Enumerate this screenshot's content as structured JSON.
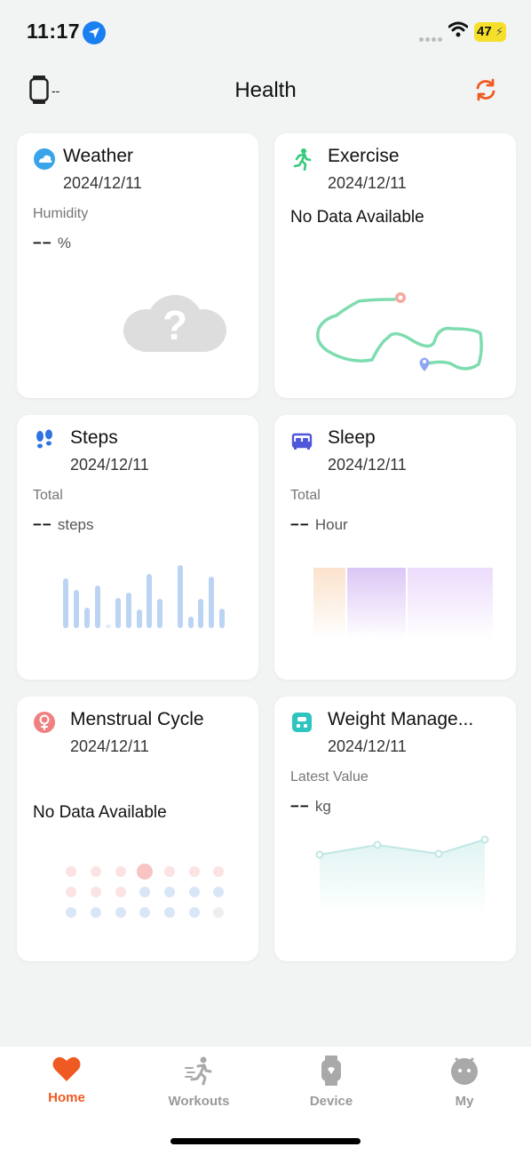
{
  "status": {
    "time": "11:17",
    "battery": "47"
  },
  "header": {
    "device_text": "--",
    "title": "Health"
  },
  "cards": {
    "weather": {
      "title": "Weather",
      "date": "2024/12/11",
      "label": "Humidity",
      "value": "−−",
      "unit": "%"
    },
    "exercise": {
      "title": "Exercise",
      "date": "2024/12/11",
      "message": "No Data Available"
    },
    "steps": {
      "title": "Steps",
      "date": "2024/12/11",
      "label": "Total",
      "value": "−−",
      "unit": "steps"
    },
    "sleep": {
      "title": "Sleep",
      "date": "2024/12/11",
      "label": "Total",
      "value": "−−",
      "unit": "Hour"
    },
    "menstrual": {
      "title": "Menstrual Cycle",
      "date": "2024/12/11",
      "message": "No Data Available"
    },
    "weight": {
      "title": "Weight Manage...",
      "date": "2024/12/11",
      "label": "Latest Value",
      "value": "−−",
      "unit": "kg"
    }
  },
  "tabs": [
    {
      "label": "Home",
      "icon": "heart-icon",
      "active": true
    },
    {
      "label": "Workouts",
      "icon": "runner-icon",
      "active": false
    },
    {
      "label": "Device",
      "icon": "watch-icon",
      "active": false
    },
    {
      "label": "My",
      "icon": "profile-icon",
      "active": false
    }
  ],
  "colors": {
    "accent": "#ee5a22",
    "steps_bar": "#bcd4f4",
    "route": "#7fdcb0"
  }
}
